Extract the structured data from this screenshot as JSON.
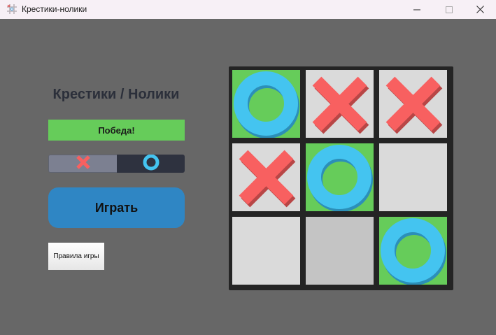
{
  "window": {
    "title": "Крестики-нолики"
  },
  "game": {
    "title": "Крестики / Нолики",
    "status": "Победа!",
    "play_label": "Играть",
    "rules_label": "Правила игры",
    "toggle": {
      "selected": "x",
      "options": [
        "x",
        "o"
      ]
    }
  },
  "board": {
    "cells": [
      {
        "mark": "o",
        "state": "win"
      },
      {
        "mark": "x",
        "state": "normal"
      },
      {
        "mark": "x",
        "state": "normal"
      },
      {
        "mark": "x",
        "state": "normal"
      },
      {
        "mark": "o",
        "state": "win"
      },
      {
        "mark": "",
        "state": "normal"
      },
      {
        "mark": "",
        "state": "normal"
      },
      {
        "mark": "",
        "state": "hover"
      },
      {
        "mark": "o",
        "state": "win"
      }
    ]
  },
  "colors": {
    "background": "#676767",
    "win": "#66cc5a",
    "cell": "#dadada",
    "hover": "#c4c4c4",
    "x_mark": "#f86060",
    "o_mark": "#44c4f0",
    "play_button": "#2f86c4"
  },
  "icons": {
    "app": "tic-tac-toe-icon",
    "x": "cross-icon",
    "o": "ring-icon"
  }
}
